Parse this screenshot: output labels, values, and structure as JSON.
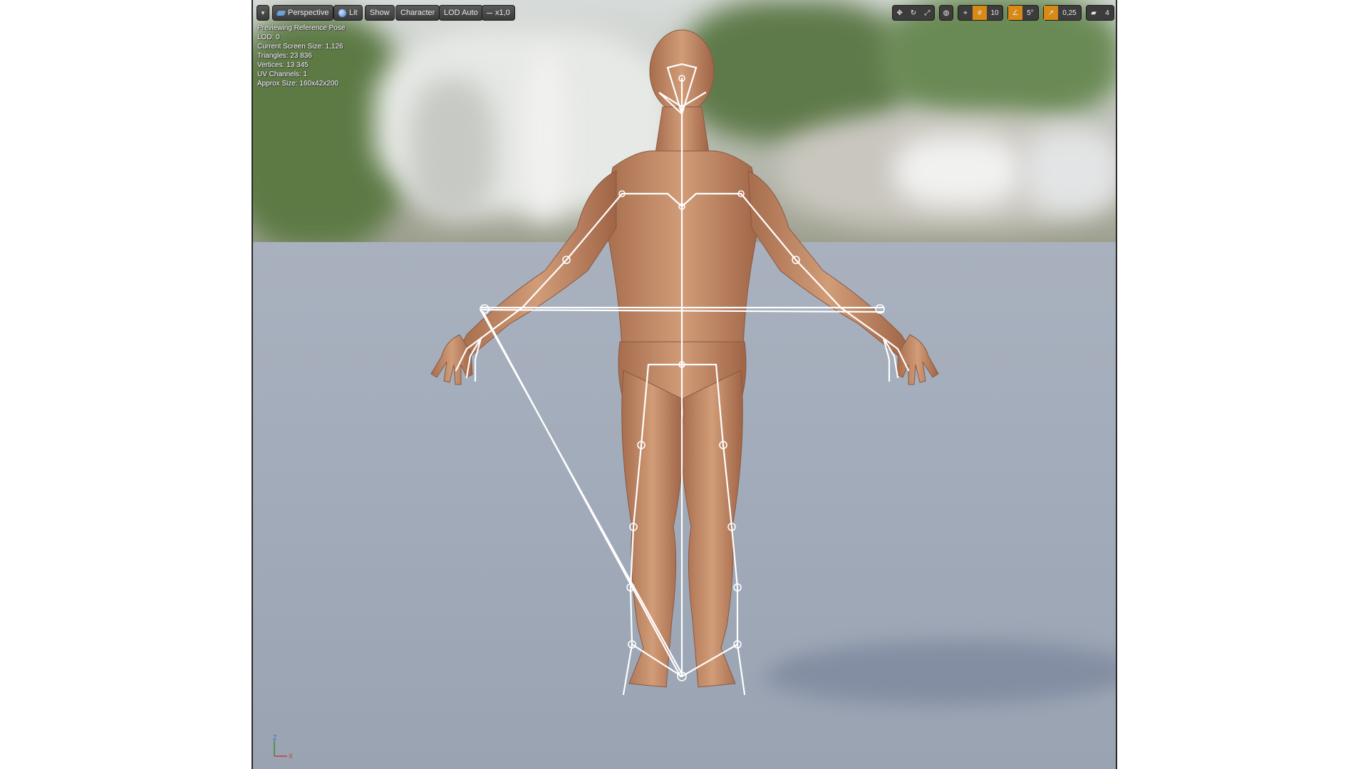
{
  "toolbar": {
    "options_label": "▾",
    "perspective_label": "Perspective",
    "lit_label": "Lit",
    "show_label": "Show",
    "character_label": "Character",
    "lod_label": "LOD Auto",
    "speed_label": "x1,0",
    "grid_snap_value": "10",
    "rotation_snap_value": "5°",
    "scale_snap_value": "0,25",
    "camera_speed_value": "4"
  },
  "stats": {
    "line1": "Previewing Reference Pose",
    "line2": "LOD: 0",
    "line3": "Current Screen Size: 1,126",
    "line4": "Triangles: 23 836",
    "line5": "Vertices: 13 345",
    "line6": "UV Channels: 1",
    "line7": "Approx Size: 160x42x200"
  },
  "axis": {
    "z": "Z",
    "x": "X"
  },
  "colors": {
    "accent": "#d88a18",
    "floor": "#a6afbd",
    "skin": "#c8906a",
    "bone": "#ffffff"
  },
  "icons": [
    "options-chevron-icon",
    "perspective-icon",
    "lit-sphere-icon",
    "translate-icon",
    "rotate-icon",
    "scale-icon",
    "coordinate-space-icon",
    "surface-snap-icon",
    "grid-snap-icon",
    "rotation-snap-icon",
    "scale-snap-icon",
    "camera-speed-icon"
  ]
}
